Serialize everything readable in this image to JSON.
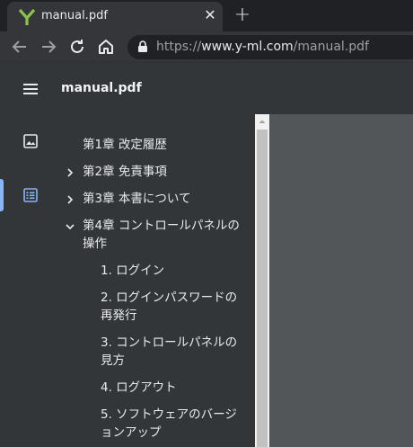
{
  "browser": {
    "tab_title": "manual.pdf",
    "url_scheme": "https://",
    "url_host": "www.y-ml.com",
    "url_path": "/manual.pdf",
    "favicon_color": "#8bc34a"
  },
  "viewer": {
    "title": "manual.pdf"
  },
  "outline": {
    "items": [
      {
        "label": "第1章 改定履歴",
        "expander": "none",
        "level": 0
      },
      {
        "label": "第2章 免責事項",
        "expander": "collapsed",
        "level": 0
      },
      {
        "label": "第3章 本書について",
        "expander": "collapsed",
        "level": 0
      },
      {
        "label": "第4章 コントロールパネルの",
        "label_2": "操作",
        "expander": "expanded",
        "level": 0
      },
      {
        "label": "1. ログイン",
        "level": 1
      },
      {
        "label": "2. ログインパスワードの",
        "label_2": "再発行",
        "level": 1
      },
      {
        "label": "3. コントロールパネルの",
        "label_2": "見方",
        "level": 1
      },
      {
        "label": "4. ログアウト",
        "level": 1
      },
      {
        "label": "5. ソフトウェアのバージ",
        "label_2": "ョンアップ",
        "level": 1
      }
    ]
  },
  "colors": {
    "accent": "#8ab4f8",
    "sidebar_bg": "#323639",
    "doc_bg": "#525659"
  }
}
